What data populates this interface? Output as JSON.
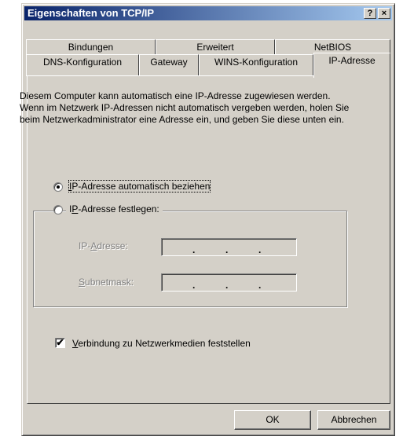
{
  "window": {
    "title": "Eigenschaften von TCP/IP",
    "help_button": "?",
    "close_button": "×"
  },
  "tabs_back": [
    "Bindungen",
    "Erweitert",
    "NetBIOS"
  ],
  "tabs_front": [
    "DNS-Konfiguration",
    "Gateway",
    "WINS-Konfiguration",
    "IP-Adresse"
  ],
  "active_tab": "IP-Adresse",
  "description": "Diesem Computer kann automatisch eine IP-Adresse zugewiesen werden. Wenn im Netzwerk IP-Adressen nicht automatisch vergeben werden, holen Sie beim Netzwerkadministrator eine Adresse ein, und geben Sie diese unten ein.",
  "option_auto": {
    "pre": "",
    "accel": "I",
    "post": "P-Adresse automatisch beziehen",
    "selected": true
  },
  "option_manual": {
    "pre": "I",
    "accel": "P",
    "post": "-Adresse festlegen:",
    "selected": false
  },
  "fields": {
    "ip": {
      "pre": "IP-",
      "accel": "A",
      "post": "dresse:",
      "value": ". . ."
    },
    "subnet": {
      "pre": "",
      "accel": "S",
      "post": "ubnetmask:",
      "value": ". . ."
    }
  },
  "checkbox": {
    "accel": "V",
    "post": "erbindung zu Netzwerkmedien feststellen",
    "checked": true,
    "mark": "✔"
  },
  "buttons": {
    "ok": "OK",
    "cancel": "Abbrechen"
  }
}
